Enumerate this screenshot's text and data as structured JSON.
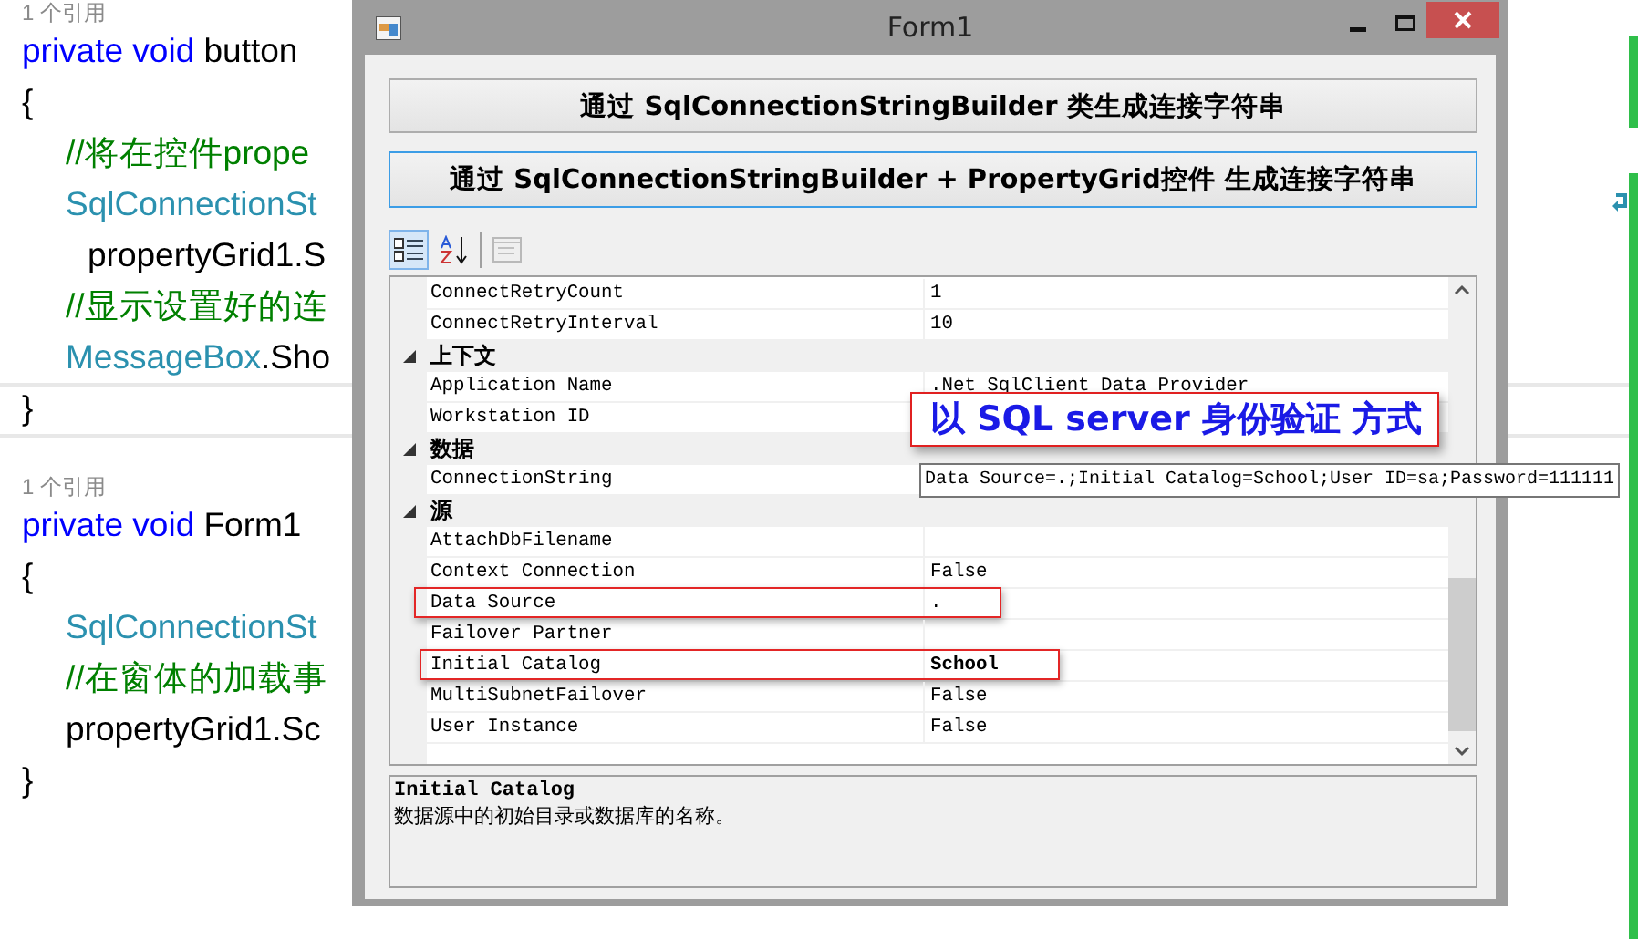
{
  "editor": {
    "methods": [
      {
        "references": "1 个引用",
        "signature": [
          {
            "kind": "keyword",
            "text": "private void "
          },
          {
            "kind": "plain",
            "text": "button"
          }
        ],
        "open": "{",
        "close": "}",
        "close_current": true,
        "body": [
          {
            "tokens": [
              {
                "kind": "comment",
                "text": "//将在控件prope"
              }
            ]
          },
          {
            "tokens": [
              {
                "kind": "type",
                "text": "SqlConnectionSt"
              }
            ],
            "children": [
              {
                "tokens": [
                  {
                    "kind": "plain",
                    "text": "propertyGrid1.S"
                  }
                ]
              }
            ]
          },
          {
            "tokens": [
              {
                "kind": "comment",
                "text": "//显示设置好的连"
              }
            ]
          },
          {
            "tokens": [
              {
                "kind": "type",
                "text": "MessageBox"
              },
              {
                "kind": "plain",
                "text": ".Sho"
              }
            ]
          }
        ]
      },
      {
        "references": "1 个引用",
        "signature": [
          {
            "kind": "keyword",
            "text": "private void "
          },
          {
            "kind": "plain",
            "text": "Form1"
          }
        ],
        "open": "{",
        "close": "}",
        "close_current": false,
        "body": [
          {
            "tokens": [
              {
                "kind": "type",
                "text": "SqlConnectionSt"
              }
            ]
          },
          {
            "tokens": [
              {
                "kind": "comment",
                "text": "//在窗体的加载事"
              }
            ]
          },
          {
            "tokens": [
              {
                "kind": "plain",
                "text": "propertyGrid1.Sc"
              }
            ]
          }
        ]
      }
    ]
  },
  "window": {
    "title": "Form1",
    "buttons": [
      {
        "label": "通过 SqlConnectionStringBuilder 类生成连接字符串",
        "focused": false
      },
      {
        "label": "通过 SqlConnectionStringBuilder + PropertyGrid控件 生成连接字符串",
        "focused": true
      }
    ],
    "toolbar": [
      {
        "kind": "categorized",
        "selected": true,
        "disabled": false
      },
      {
        "kind": "alphabetical",
        "selected": false,
        "disabled": false
      },
      {
        "kind": "separator"
      },
      {
        "kind": "property-pages",
        "selected": false,
        "disabled": true
      }
    ],
    "grid": [
      {
        "kind": "property",
        "name": "ConnectRetryCount",
        "value": "1"
      },
      {
        "kind": "property",
        "name": "ConnectRetryInterval",
        "value": "10"
      },
      {
        "kind": "category",
        "name": "上下文",
        "expanded": true
      },
      {
        "kind": "property",
        "name": "Application Name",
        "value": ".Net SqlClient Data Provider"
      },
      {
        "kind": "property",
        "name": "Workstation ID"
      },
      {
        "kind": "category",
        "name": "数据",
        "expanded": true
      },
      {
        "kind": "property",
        "name": "ConnectionString",
        "tooltip": "Data Source=.;Initial Catalog=School;User ID=sa;Password=111111"
      },
      {
        "kind": "category",
        "name": "源",
        "expanded": true
      },
      {
        "kind": "property",
        "name": "AttachDbFilename"
      },
      {
        "kind": "property",
        "name": "Context Connection",
        "value": "False"
      },
      {
        "kind": "property",
        "name": "Data Source",
        "value": ".",
        "highlighted": true
      },
      {
        "kind": "property",
        "name": "Failover Partner"
      },
      {
        "kind": "property",
        "name": "Initial Catalog",
        "value": "School",
        "modified": true,
        "highlighted": true
      },
      {
        "kind": "property",
        "name": "MultiSubnetFailover",
        "value": "False"
      },
      {
        "kind": "property",
        "name": "User Instance",
        "value": "False"
      }
    ],
    "callout": "以 SQL server 身份验证 方式",
    "description": {
      "title": "Initial Catalog",
      "text": "数据源中的初始目录或数据库的名称。"
    }
  }
}
